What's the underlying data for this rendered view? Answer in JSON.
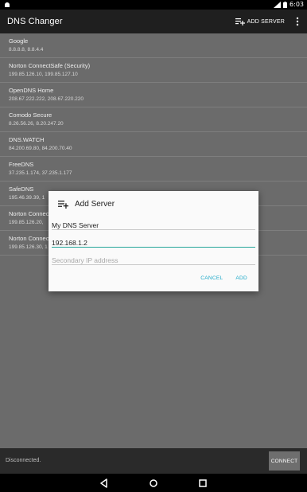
{
  "status_bar": {
    "time": "6:03",
    "left_icon": "android-icon",
    "signal_icon": "signal-icon",
    "battery_icon": "battery-icon"
  },
  "app_bar": {
    "title": "DNS Changer",
    "add_server_label": "ADD SERVER",
    "add_icon": "playlist-add-icon",
    "overflow_icon": "more-vert-icon"
  },
  "servers": [
    {
      "name": "Google",
      "ips": "8.8.8.8, 8.8.4.4"
    },
    {
      "name": "Norton ConnectSafe (Security)",
      "ips": "199.85.126.10, 199.85.127.10"
    },
    {
      "name": "OpenDNS Home",
      "ips": "208.67.222.222, 208.67.220.220"
    },
    {
      "name": "Comodo Secure",
      "ips": "8.26.56.26, 8.20.247.20"
    },
    {
      "name": "DNS.WATCH",
      "ips": "84.200.69.80, 84.200.70.40"
    },
    {
      "name": "FreeDNS",
      "ips": "37.235.1.174, 37.235.1.177"
    },
    {
      "name": "SafeDNS",
      "ips": "195.46.39.39, 1"
    },
    {
      "name": "Norton Connec",
      "ips": "199.85.126.20, "
    },
    {
      "name": "Norton Connec",
      "ips": "199.85.126.30, 1"
    }
  ],
  "dialog": {
    "title": "Add Server",
    "title_icon": "playlist-add-icon",
    "name_value": "My DNS Server",
    "primary_value": "192.168.1.2",
    "secondary_placeholder": "Secondary IP address",
    "cancel_label": "CANCEL",
    "add_label": "ADD",
    "accent_color": "#26a69a",
    "button_color": "#1aa8c8"
  },
  "bottom_bar": {
    "status": "Disconnected.",
    "connect_label": "CONNECT"
  },
  "nav_bar": {
    "back_icon": "back-icon",
    "home_icon": "home-icon",
    "recents_icon": "recents-icon"
  }
}
